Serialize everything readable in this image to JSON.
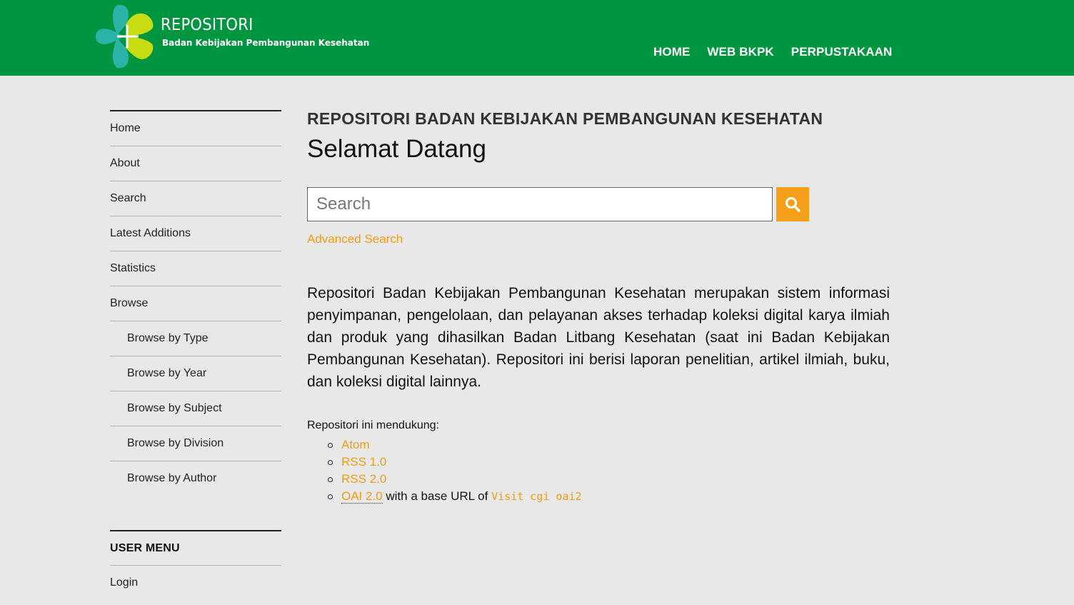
{
  "header": {
    "brand_title": "REPOSITORI",
    "brand_subtitle": "Badan Kebijakan Pembangunan Kesehatan",
    "nav": [
      "HOME",
      "WEB BKPK",
      "PERPUSTAKAAN"
    ],
    "bg_color": "#009640"
  },
  "sidebar": {
    "items": [
      {
        "label": "Home"
      },
      {
        "label": "About"
      },
      {
        "label": "Search"
      },
      {
        "label": "Latest Additions"
      },
      {
        "label": "Statistics"
      },
      {
        "label": "Browse"
      },
      {
        "label": "Browse by Type"
      },
      {
        "label": "Browse by Year"
      },
      {
        "label": "Browse by Subject"
      },
      {
        "label": "Browse by Division"
      },
      {
        "label": "Browse by Author"
      }
    ],
    "user_menu_title": "USER MENU",
    "login_label": "Login"
  },
  "main": {
    "subtitle": "REPOSITORI BADAN KEBIJAKAN PEMBANGUNAN KESEHATAN",
    "title": "Selamat Datang",
    "search_placeholder": "Search",
    "advanced_search": "Advanced Search",
    "intro": "Repositori Badan Kebijakan Pembangunan Kesehatan merupakan sistem informasi penyimpanan, pengelolaan, dan pelayanan akses terhadap koleksi digital karya ilmiah dan produk yang dihasilkan Badan Litbang Kesehatan (saat ini Badan Kebijakan Pembangunan Kesehatan). Repositori ini berisi laporan penelitian, artikel ilmiah, buku, dan koleksi digital lainnya.",
    "supports_label": "Repositori ini mendukung:",
    "feeds": [
      "Atom",
      "RSS 1.0",
      "RSS 2.0"
    ],
    "oai_label": "OAI 2.0",
    "oai_text": " with a base URL of ",
    "oai_url": "Visit cgi oai2"
  },
  "colors": {
    "accent": "#f39c12",
    "search_button": "#f5a018"
  },
  "icons": {
    "logo": "plus-leaf-logo-icon",
    "search": "search-icon"
  }
}
